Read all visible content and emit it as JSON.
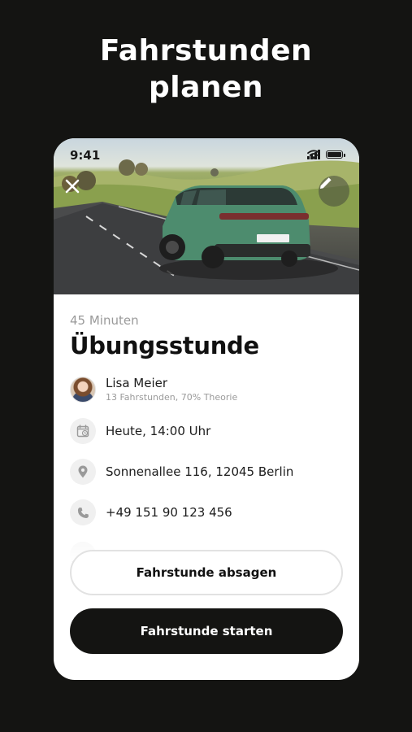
{
  "headline": {
    "line1": "Fahrstunden",
    "line2": "planen"
  },
  "status_bar": {
    "time": "9:41"
  },
  "hero": {
    "plate": "B-LN 1234"
  },
  "lesson": {
    "duration": "45 Minuten",
    "title": "Übungsstunde"
  },
  "instructor": {
    "name": "Lisa Meier",
    "details": "13 Fahrstunden, 70% Theorie"
  },
  "details": {
    "date": "Heute, 14:00 Uhr",
    "address": "Sonnenallee 116, 12045 Berlin",
    "phone": "+49 151 90 123 456"
  },
  "actions": {
    "cancel_label": "Fahrstunde absagen",
    "start_label": "Fahrstunde starten"
  },
  "colors": {
    "background": "#141412",
    "accent": "#141412",
    "card": "#ffffff",
    "icon_bg": "#f0f0f0"
  }
}
